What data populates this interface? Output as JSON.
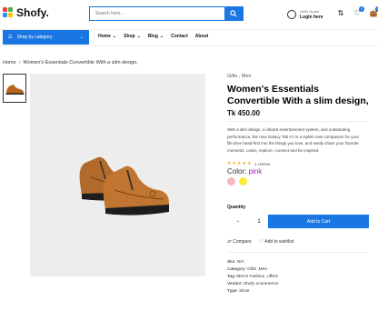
{
  "brand": {
    "name": "Shofy.",
    "colors": {
      "accent": "#1976e3",
      "logo1": "#f44336",
      "logo2": "#4caf50",
      "logo3": "#2196f3",
      "logo4": "#ffc107"
    }
  },
  "search": {
    "placeholder": "Search here..."
  },
  "account": {
    "hello": "Hello Guest",
    "login": "Login here"
  },
  "header_icons": {
    "compare_count": "",
    "wishlist_count": "0",
    "cart_count": "0"
  },
  "nav": {
    "category_button": "Shop by category",
    "items": [
      "Home",
      "Shop",
      "Blog",
      "Contact",
      "About"
    ]
  },
  "breadcrumb": {
    "home": "Home",
    "current": "Women's Essentials Convertible With a slim design,"
  },
  "product": {
    "category": "Gifts , Men",
    "title": "Women's Essentials Convertible With a slim design,",
    "price": "Tk 450.00",
    "description": "With a slim design, a vibrant entertainment system, and outstanding performance, the new Galaxy Tab A7 is a stylish new companion for your life.Dive head-first into the things you love, and easily share your favorite moments. Learn, explore, connect and be inspired.",
    "rating_stars": 5,
    "review_text": "1 review",
    "color_label": "Color:",
    "color_value": "pink",
    "swatches": [
      "#f8b8c0",
      "#ffeb3b"
    ],
    "quantity_label": "Quantity",
    "quantity": "1",
    "add_to_cart": "Add to Cart",
    "compare": "Compare",
    "wishlist": "Add to wishlist",
    "meta": [
      {
        "label": "Sku:",
        "value": "N/A"
      },
      {
        "label": "Category:",
        "value": "Gifts ,Men"
      },
      {
        "label": "Tag:",
        "value": "Men's Fashion ,offers"
      },
      {
        "label": "Vendor:",
        "value": "Shofy ecommerce"
      },
      {
        "label": "Type:",
        "value": "Shoe"
      }
    ]
  }
}
